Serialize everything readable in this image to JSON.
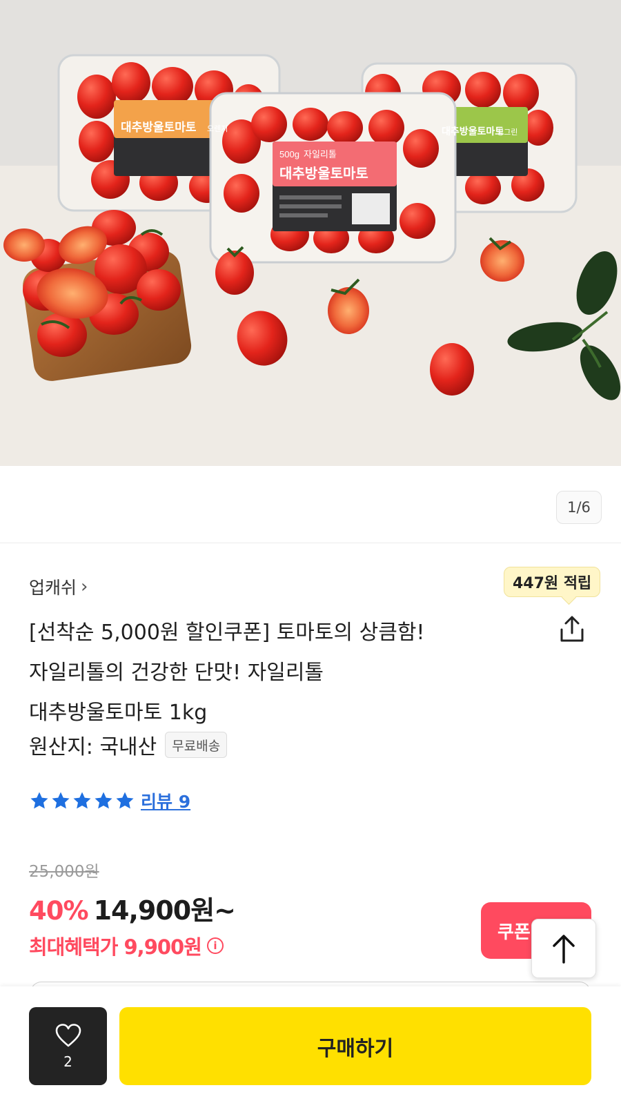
{
  "gallery": {
    "counter": "1/6",
    "package_labels": {
      "weight": "500g",
      "brand": "자일리톨",
      "name": "대추방울토마토",
      "left_flavor": "오렌지",
      "right_flavor": "싱그린"
    },
    "label_colors": {
      "left": "#f3a24a",
      "center": "#f36c73",
      "right": "#9cc64a"
    }
  },
  "product": {
    "seller": "업캐쉬",
    "points_badge": "447원 적립",
    "title_lines": [
      "[선착순 5,000원 할인쿠폰] 토마토의 상큼함!",
      "자일리톨의 건강한 단맛! 자일리톨",
      "대추방울토마토 1kg"
    ],
    "origin": "원산지: 국내산",
    "shipping_badge": "무료배송",
    "rating_stars": 5,
    "review_link": "리뷰 9"
  },
  "pricing": {
    "original_price": "25,000원",
    "discount_rate": "40%",
    "sale_price": "14,900원~",
    "max_benefit": "최대혜택가 9,900원",
    "coupon_button": "쿠폰",
    "accent_color": "#ff4a5f"
  },
  "bottom_bar": {
    "like_count": "2",
    "buy_label": "구매하기",
    "buy_color": "#ffe000"
  },
  "icons": [
    "heart-icon",
    "share-icon",
    "star-icon",
    "info-icon",
    "arrow-up-icon",
    "chevron-right-icon"
  ]
}
